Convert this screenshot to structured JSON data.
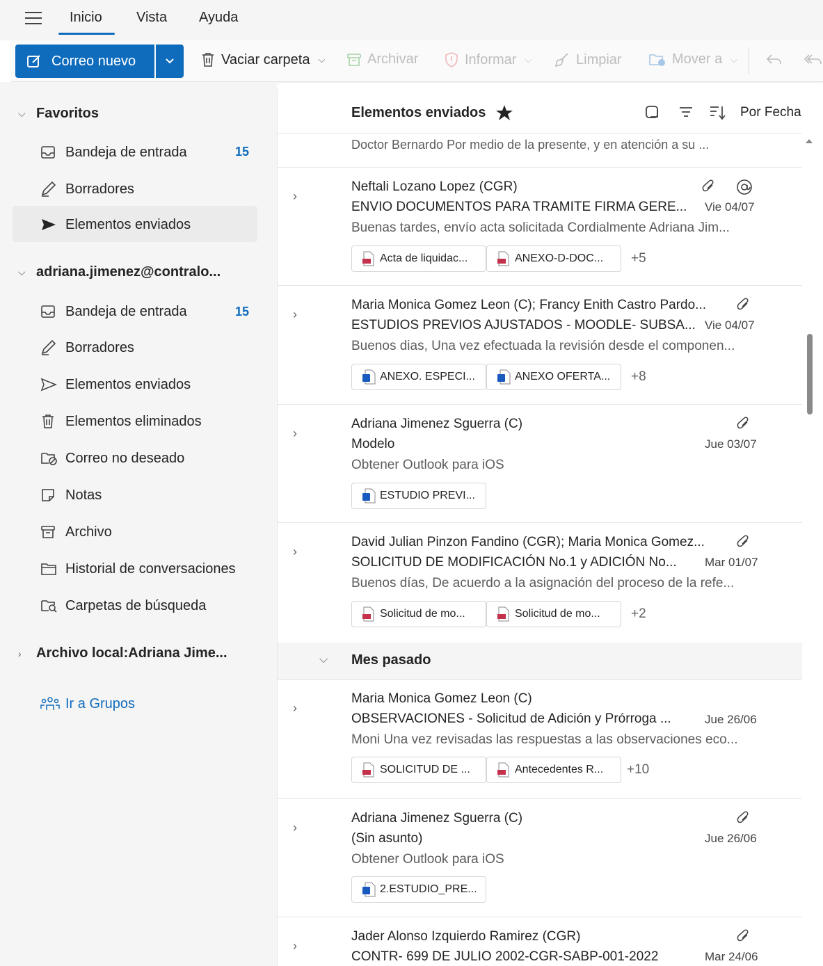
{
  "tabs": [
    {
      "label": "Inicio",
      "active": true
    },
    {
      "label": "Vista",
      "active": false
    },
    {
      "label": "Ayuda",
      "active": false
    }
  ],
  "ribbon": {
    "new_mail": "Correo nuevo",
    "empty_folder": "Vaciar carpeta",
    "archive": "Archivar",
    "report": "Informar",
    "sweep": "Limpiar",
    "move_to": "Mover a"
  },
  "sidebar": {
    "favorites": {
      "title": "Favoritos",
      "items": [
        {
          "label": "Bandeja de entrada",
          "icon": "inbox-icon",
          "count": "15"
        },
        {
          "label": "Borradores",
          "icon": "drafts-icon"
        },
        {
          "label": "Elementos enviados",
          "icon": "sent-icon",
          "selected": true
        }
      ]
    },
    "account": {
      "title": "adriana.jimenez@contralo...",
      "items": [
        {
          "label": "Bandeja de entrada",
          "icon": "inbox-icon",
          "count": "15"
        },
        {
          "label": "Borradores",
          "icon": "drafts-icon"
        },
        {
          "label": "Elementos enviados",
          "icon": "sent-icon"
        },
        {
          "label": "Elementos eliminados",
          "icon": "trash-icon"
        },
        {
          "label": "Correo no deseado",
          "icon": "junk-icon"
        },
        {
          "label": "Notas",
          "icon": "notes-icon"
        },
        {
          "label": "Archivo",
          "icon": "archive-icon"
        },
        {
          "label": "Historial de conversaciones",
          "icon": "folder-icon"
        },
        {
          "label": "Carpetas de búsqueda",
          "icon": "search-folder-icon"
        }
      ]
    },
    "local_archive": "Archivo local:Adriana Jime...",
    "groups_link": "Ir a Grupos"
  },
  "list": {
    "title": "Elementos enviados",
    "sort_label": "Por Fecha",
    "top_preview": "Doctor Bernardo Por medio de la presente, y en atención a su ...",
    "group_label": "Mes pasado",
    "messages": [
      {
        "from": "Neftali Lozano Lopez (CGR)",
        "subject": "ENVIO DOCUMENTOS PARA TRAMITE FIRMA GERE...",
        "date": "Vie 04/07",
        "preview": "Buenas tardes, envío acta solicitada Cordialmente Adriana Jim...",
        "attachments": [
          {
            "name": "Acta de liquidac...",
            "type": "pdf"
          },
          {
            "name": "ANEXO-D-DOC...",
            "type": "pdf"
          }
        ],
        "more": "+5"
      },
      {
        "from": "Maria Monica Gomez Leon (C); Francy Enith Castro Pardo...",
        "subject": "ESTUDIOS PREVIOS AJUSTADOS - MOODLE- SUBSA...",
        "date": "Vie 04/07",
        "preview": "Buenos dias, Una vez efectuada la revisión desde el componen...",
        "attachments": [
          {
            "name": "ANEXO. ESPECI...",
            "type": "word"
          },
          {
            "name": "ANEXO OFERTA...",
            "type": "word"
          }
        ],
        "more": "+8"
      },
      {
        "from": "Adriana Jimenez Sguerra (C)",
        "subject": "Modelo",
        "date": "Jue 03/07",
        "preview": "Obtener Outlook para iOS",
        "attachments": [
          {
            "name": "ESTUDIO PREVI...",
            "type": "word"
          }
        ],
        "more": ""
      },
      {
        "from": "David Julian Pinzon Fandino (CGR); Maria Monica Gomez...",
        "subject": "SOLICITUD DE MODIFICACIÓN No.1 y ADICIÓN No...",
        "date": "Mar 01/07",
        "preview": "Buenos días, De acuerdo a la asignación del proceso de la refe...",
        "attachments": [
          {
            "name": "Solicitud de mo...",
            "type": "pdf"
          },
          {
            "name": "Solicitud de mo...",
            "type": "pdf"
          }
        ],
        "more": "+2"
      },
      {
        "from": "Maria Monica Gomez Leon (C)",
        "subject": "OBSERVACIONES - Solicitud de Adición y Prórroga ...",
        "date": "Jue 26/06",
        "preview": "Moni Una vez revisadas las respuestas a las observaciones eco...",
        "attachments": [
          {
            "name": "SOLICITUD DE ...",
            "type": "pdf"
          },
          {
            "name": "Antecedentes R...",
            "type": "pdf"
          }
        ],
        "more": "+10"
      },
      {
        "from": "Adriana Jimenez Sguerra (C)",
        "subject": "(Sin asunto)",
        "date": "Jue 26/06",
        "preview": "Obtener Outlook para iOS",
        "attachments": [
          {
            "name": "2.ESTUDIO_PRE...",
            "type": "word"
          }
        ],
        "more": ""
      },
      {
        "from": "Jader Alonso Izquierdo Ramirez (CGR)",
        "subject": "CONTR- 699 DE JULIO 2002-CGR-SABP-001-2022",
        "date": "Mar 24/06",
        "preview": "",
        "attachments": [],
        "more": ""
      }
    ]
  },
  "colors": {
    "accent": "#0f6cbd",
    "pdf": "#c4314b",
    "word": "#185abd"
  }
}
